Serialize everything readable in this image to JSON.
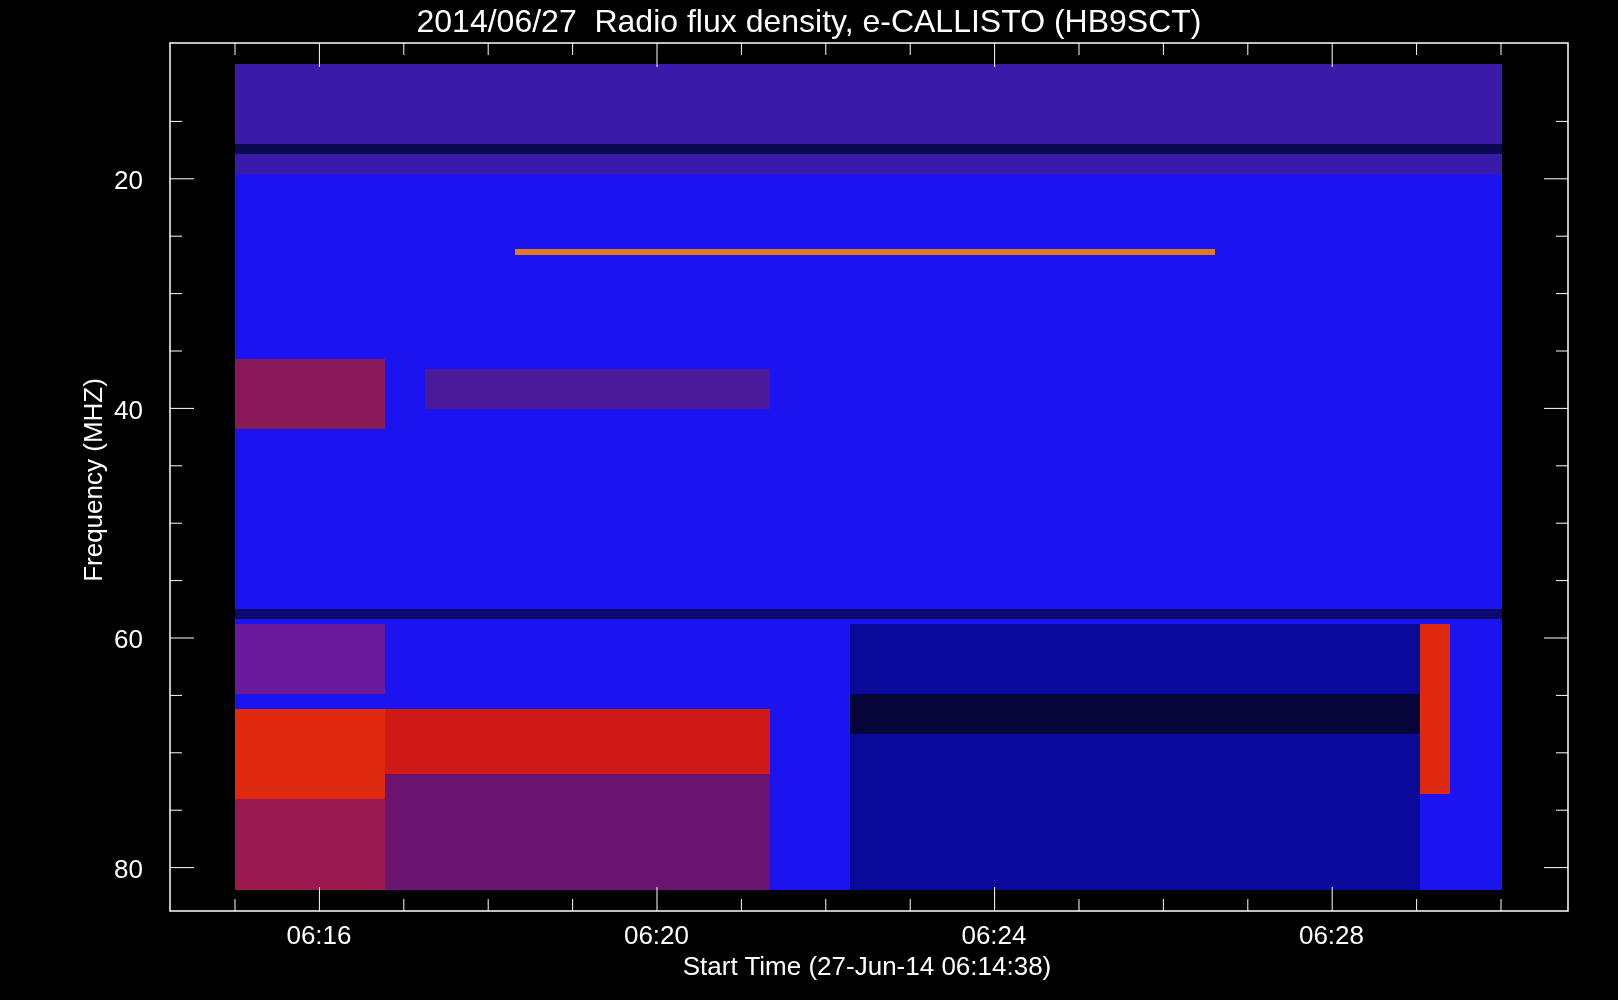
{
  "title": "2014/06/27  Radio flux density, e-CALLISTO (HB9SCT)",
  "y_axis": {
    "label": "Frequency (MHZ)",
    "ticks": [
      "20",
      "40",
      "60",
      "80"
    ]
  },
  "x_axis": {
    "label": "Start Time (27-Jun-14 06:14:38)",
    "ticks": [
      "06:16",
      "06:20",
      "06:24",
      "06:28"
    ]
  }
}
